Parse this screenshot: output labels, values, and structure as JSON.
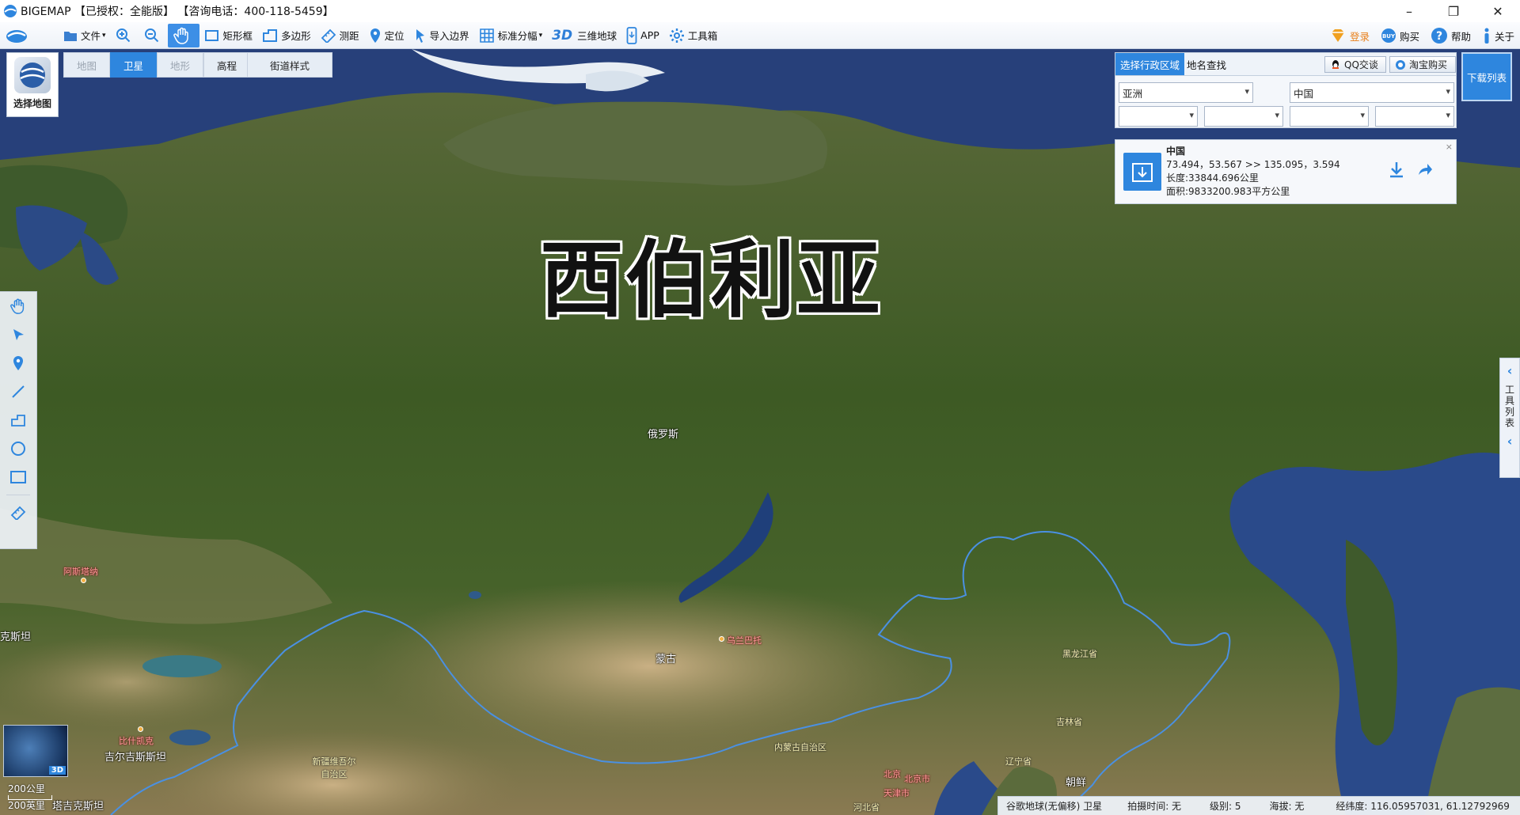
{
  "window": {
    "title": "BIGEMAP 【已授权：全能版】 【咨询电话：400-118-5459】",
    "minimize": "–",
    "restore": "❐",
    "close": "✕"
  },
  "toolbar": {
    "items": [
      {
        "label": "文件",
        "icon": "folder-icon",
        "has_caret": true
      },
      {
        "label": "",
        "icon": "zoom-in-icon"
      },
      {
        "label": "",
        "icon": "zoom-out-icon"
      },
      {
        "label": "",
        "icon": "pan-hand-icon",
        "active": true
      },
      {
        "label": "矩形框",
        "icon": "rectangle-select-icon"
      },
      {
        "label": "多边形",
        "icon": "polygon-select-icon"
      },
      {
        "label": "测距",
        "icon": "ruler-icon"
      },
      {
        "label": "定位",
        "icon": "location-pin-icon"
      },
      {
        "label": "导入边界",
        "icon": "import-boundary-icon"
      },
      {
        "label": "标准分幅",
        "icon": "grid-icon",
        "has_caret": true
      },
      {
        "label": "三维地球",
        "icon": "3d-icon",
        "prefix": "3D"
      },
      {
        "label": "APP",
        "icon": "phone-icon"
      },
      {
        "label": "工具箱",
        "icon": "gear-icon"
      }
    ],
    "right": {
      "login": "登录",
      "buy": "购买",
      "help": "帮助",
      "about": "关于"
    }
  },
  "map_controls": {
    "selector_label": "选择地图",
    "tabs": [
      "地图",
      "卫星",
      "地形",
      "高程"
    ],
    "active_tab": "卫星",
    "street_style": "街道样式"
  },
  "panel": {
    "tab_region": "选择行政区域",
    "tab_search": "地名查找",
    "qq_button": "QQ交谈",
    "taobao_button": "淘宝购买",
    "download_list": "下载列表",
    "continent": "亚洲",
    "country": "中国",
    "level3": "",
    "level4": "",
    "level5": "",
    "level6": "",
    "card": {
      "name": "中国",
      "bounds": "73.494，53.567 >> 135.095，3.594",
      "length": "长度:33844.696公里",
      "area": "面积:9833200.983平方公里",
      "close": "×"
    }
  },
  "side_tools_label": "工具列表",
  "map_labels": {
    "big": "西伯利亚",
    "russia": "俄罗斯",
    "mongolia": "蒙古",
    "ulaanbaatar": "乌兰巴托",
    "heilongjiang": "黑龙江省",
    "jilin": "吉林省",
    "liaoning": "辽宁省",
    "inner_mongolia": "内蒙古自治区",
    "beijing_province": "北京",
    "beijing_city": "北京市",
    "tianjin": "天津市",
    "hebei": "河北省",
    "korea": "朝鲜",
    "xinjiang": "新疆维吾尔自治区",
    "kyrgyzstan": "吉尔吉斯斯坦",
    "bishkek": "比什凯克",
    "astana": "阿斯塔纳",
    "kazakhstan_edge": "克斯坦",
    "tajikistan": "塔吉克斯坦"
  },
  "scale": {
    "metric": "200公里",
    "imperial": "200英里"
  },
  "minimap_badge": "3D",
  "status": {
    "source": "谷歌地球(无偏移) 卫星",
    "capture_time": "拍摄时间: 无",
    "level": "级别:  5",
    "altitude": "海拔: 无",
    "coords": "经纬度:  116.05957031, 61.12792969"
  },
  "colors": {
    "accent": "#2e86de",
    "border_line": "#4a90e2"
  }
}
